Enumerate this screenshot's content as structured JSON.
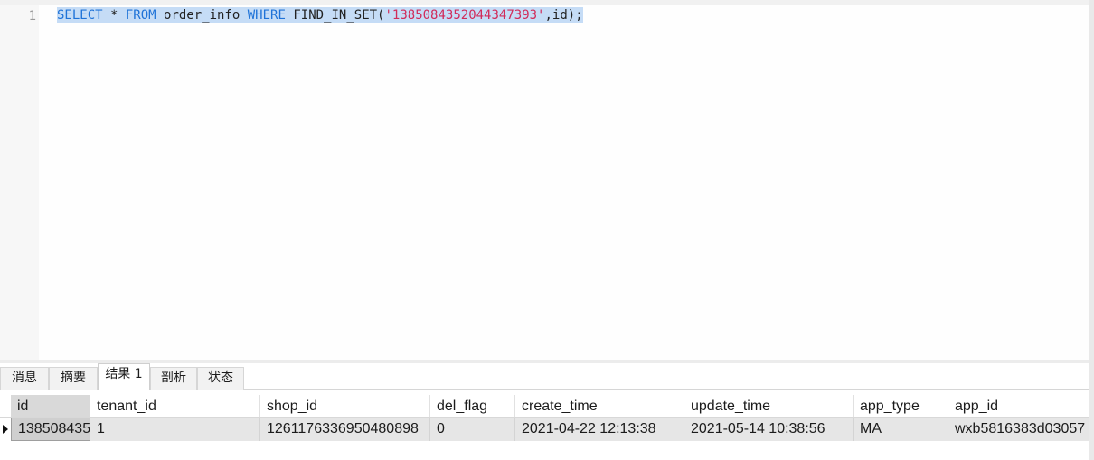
{
  "editor": {
    "line_number": "1",
    "tokens": {
      "select": "SELECT",
      "star": " * ",
      "from": "FROM",
      "table": " order_info ",
      "where": "WHERE",
      "func": " FIND_IN_SET(",
      "literal": "'1385084352044347393'",
      "tail": ",id);"
    }
  },
  "tabs": [
    {
      "label": "消息"
    },
    {
      "label": "摘要"
    },
    {
      "label": "结果 1"
    },
    {
      "label": "剖析"
    },
    {
      "label": "状态"
    }
  ],
  "active_tab": "结果 1",
  "grid": {
    "columns": [
      "id",
      "tenant_id",
      "shop_id",
      "del_flag",
      "create_time",
      "update_time",
      "app_type",
      "app_id"
    ],
    "rows": [
      {
        "id": "138508435",
        "tenant_id": "1",
        "shop_id": "1261176336950480898",
        "del_flag": "0",
        "create_time": "2021-04-22 12:13:38",
        "update_time": "2021-05-14 10:38:56",
        "app_type": "MA",
        "app_id": "wxb5816383d03057"
      }
    ]
  },
  "colors": {
    "keyword": "#1f73d8",
    "string_literal": "#d12b5a",
    "selection": "#c5dcf6",
    "row_selected": "#e6e6e6"
  }
}
